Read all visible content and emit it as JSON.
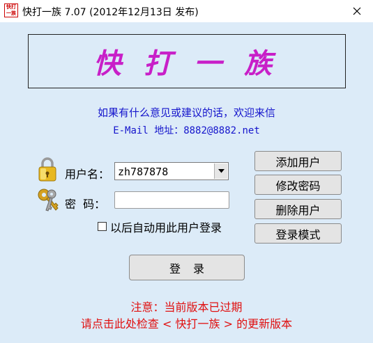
{
  "window": {
    "icon_text": "快打一族",
    "title": "快打一族 7.07 (2012年12月13日 发布)",
    "close_label": "✕"
  },
  "banner": {
    "text": "快打一族"
  },
  "info": {
    "suggestion": "如果有什么意见或建议的话，欢迎来信",
    "email": "E-Mail 地址：8882@8882.net"
  },
  "form": {
    "username_label": "用户名：",
    "username_value": "zh787878",
    "password_label": "密  码：",
    "password_value": "",
    "auto_login_label": "以后自动用此用户登录",
    "auto_login_checked": false
  },
  "buttons": {
    "add_user": "添加用户",
    "change_password": "修改密码",
    "delete_user": "删除用户",
    "login_mode": "登录模式",
    "login": "登录"
  },
  "footer": {
    "notice": "注意：当前版本已过期",
    "update_link": "请点击此处检查 < 快打一族 > 的更新版本"
  },
  "colors": {
    "banner_text": "#c81fc8",
    "info_text": "#1515cc",
    "warning_text": "#e01010",
    "client_bg": "#dcebf8"
  }
}
